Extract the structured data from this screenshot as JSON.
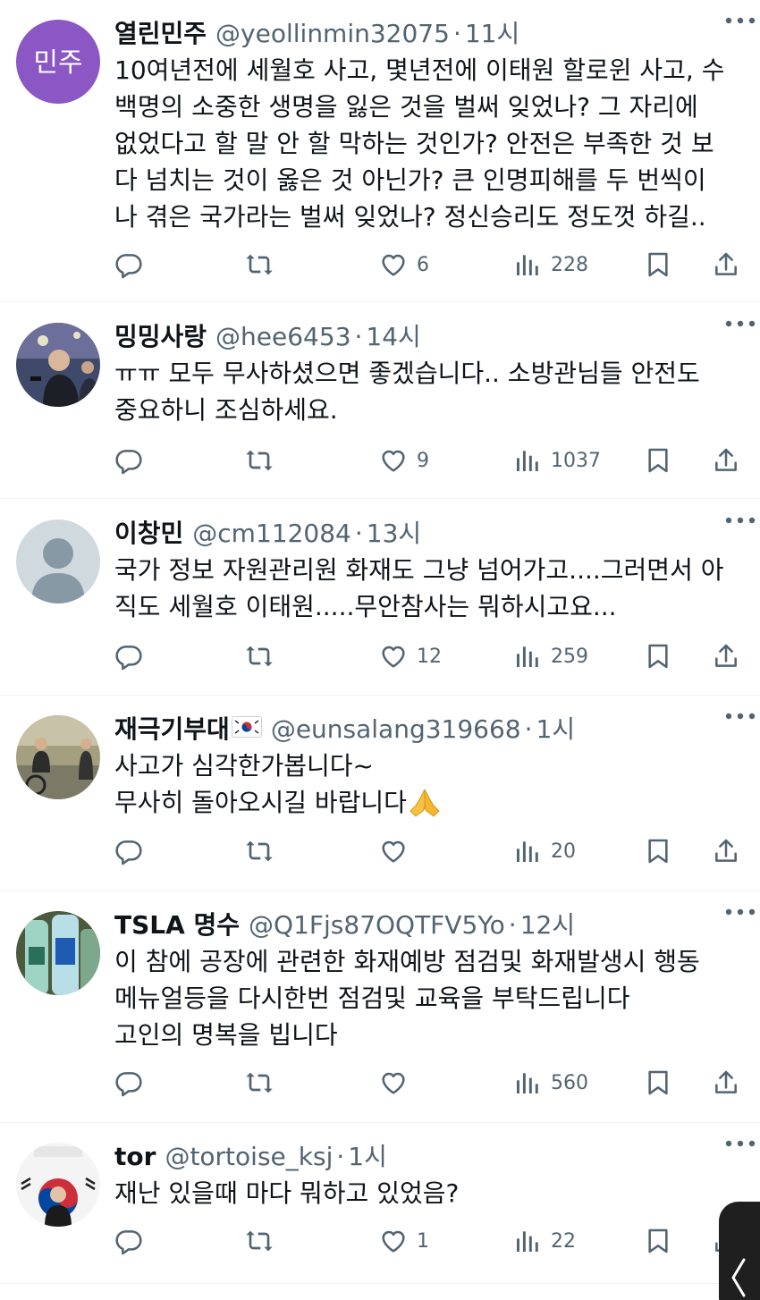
{
  "tweets": [
    {
      "name": "열린민주",
      "handle": "@yeollinmin32075",
      "time": "11시",
      "avatar_text": "민주",
      "avatar_color": "#8a57c4",
      "lines": [
        "10여년전에 세월호 사고, 몇년전에 이태원 할로윈 사고, 수",
        "백명의 소중한 생명을 잃은 것을 벌써 잊었나? 그 자리에",
        "없었다고 할 말 안 할 막하는 것인가? 안전은 부족한 것 보",
        "다 넘치는 것이 옳은 것 아닌가? 큰 인명피해를 두 번씩이",
        "나 겪은 국가라는 벌써 잊었나? 정신승리도 정도껏 하길.."
      ],
      "likes": "6",
      "views": "228"
    },
    {
      "name": "밍밍사랑",
      "handle": "@hee6453",
      "time": "14시",
      "lines": [
        "ㅠㅠ 모두 무사하셨으면 좋겠습니다.. 소방관님들 안전도",
        "중요하니 조심하세요."
      ],
      "likes": "9",
      "views": "1037"
    },
    {
      "name": "이창민",
      "handle": "@cm112084",
      "time": "13시",
      "lines": [
        "국가 정보 자원관리원 화재도 그냥 넘어가고....그러면서 아",
        "직도 세월호 이태원.....무안참사는 뭐하시고요..."
      ],
      "likes": "12",
      "views": "259"
    },
    {
      "name": "재극기부대",
      "handle": "@eunsalang319668",
      "time": "1시",
      "lines": [
        "사고가 심각한가봅니다~",
        "무사히 돌아오시길 바랍니다"
      ],
      "likes": "",
      "views": "20"
    },
    {
      "name": "TSLA 명수",
      "handle": "@Q1Fjs87OQTFV5Yo",
      "time": "12시",
      "lines": [
        "이 참에 공장에 관련한 화재예방 점검및 화재발생시 행동",
        "메뉴얼등을 다시한번 점검및 교육을 부탁드립니다",
        "고인의 명복을 빕니다"
      ],
      "likes": "",
      "views": "560"
    },
    {
      "name": "tor",
      "handle": "@tortoise_ksj",
      "time": "1시",
      "lines": [
        "재난 있을때 마다 뭐하고 있었음?"
      ],
      "likes": "1",
      "views": "22"
    }
  ],
  "dot": "·",
  "icons": [
    "reply-icon",
    "retweet-icon",
    "like-icon",
    "views-icon",
    "bookmark-icon",
    "share-icon",
    "more-icon"
  ],
  "colors": {
    "text": "#0f1419",
    "secondary": "#536471",
    "divider": "#eff3f4"
  }
}
